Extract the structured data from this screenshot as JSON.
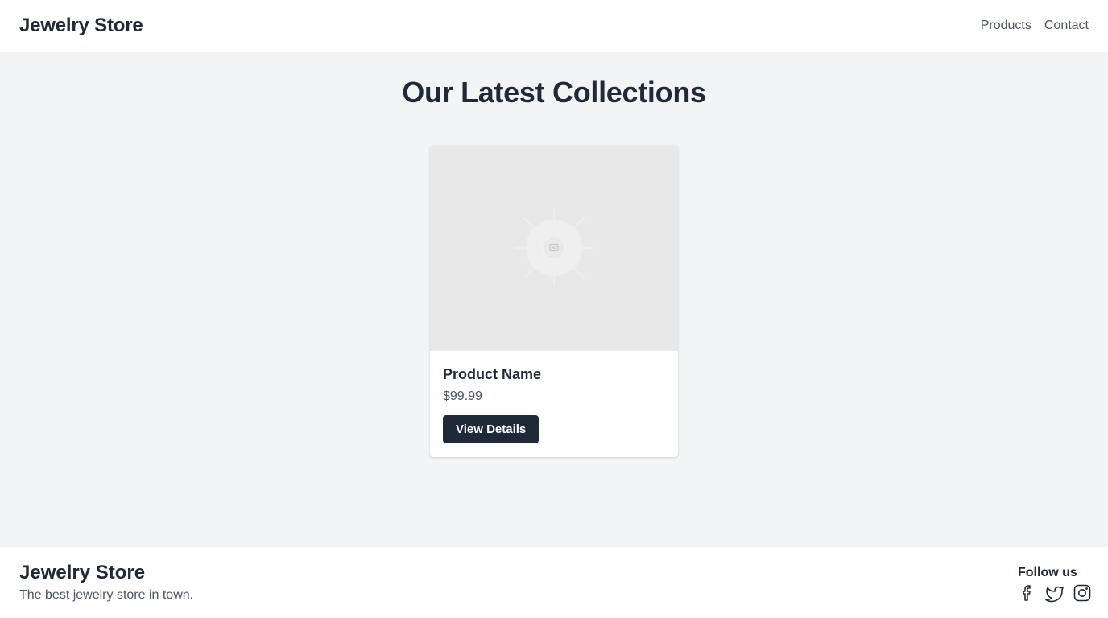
{
  "header": {
    "brand": "Jewelry Store",
    "nav": [
      {
        "label": "Products"
      },
      {
        "label": "Contact"
      }
    ]
  },
  "main": {
    "title": "Our Latest Collections",
    "products": [
      {
        "image_icon": "image-placeholder-icon",
        "name": "Product Name",
        "price": "$99.99",
        "button_label": "View Details"
      }
    ]
  },
  "footer": {
    "brand": "Jewelry Store",
    "tagline": "The best jewelry store in town.",
    "follow_title": "Follow us",
    "socials": [
      {
        "icon": "facebook-icon"
      },
      {
        "icon": "twitter-icon"
      },
      {
        "icon": "instagram-icon"
      }
    ]
  },
  "colors": {
    "primary": "#1f2937",
    "text_muted": "#4b5563",
    "background": "#f3f4f6",
    "surface": "#ffffff"
  }
}
